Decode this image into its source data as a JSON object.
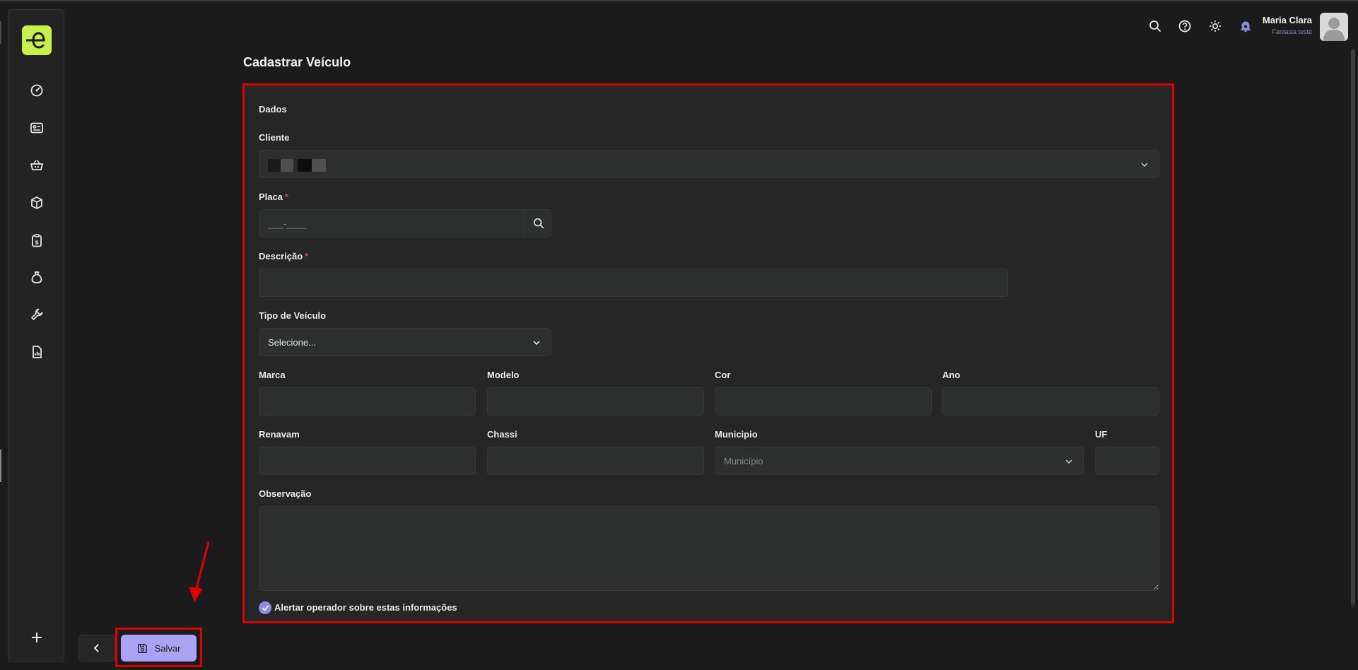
{
  "header": {
    "user_name": "Maria Clara",
    "user_company": "Fantasia teste",
    "icons": [
      "search-icon",
      "help-icon",
      "theme-sun-icon",
      "notifications-icon"
    ]
  },
  "sidebar": {
    "items": [
      "dashboard-icon",
      "id-card-icon",
      "basket-icon",
      "box-icon",
      "clipboard-dollar-icon",
      "money-bag-icon",
      "wrench-icon",
      "report-icon"
    ],
    "add_icon": "plus-icon"
  },
  "page": {
    "title": "Cadastrar Veículo"
  },
  "form": {
    "section_title": "Dados",
    "cliente": {
      "label": "Cliente"
    },
    "placa": {
      "label": "Placa",
      "required": "*",
      "placeholder": "___-____"
    },
    "descricao": {
      "label": "Descrição",
      "required": "*"
    },
    "tipo_veiculo": {
      "label": "Tipo de Veículo",
      "value": "Selecione..."
    },
    "marca": {
      "label": "Marca"
    },
    "modelo": {
      "label": "Modelo"
    },
    "cor": {
      "label": "Cor"
    },
    "ano": {
      "label": "Ano"
    },
    "renavam": {
      "label": "Renavam"
    },
    "chassi": {
      "label": "Chassi"
    },
    "municipio": {
      "label": "Municipio",
      "placeholder": "Município"
    },
    "uf": {
      "label": "UF"
    },
    "observacao": {
      "label": "Observação"
    },
    "alertar": {
      "label": "Alertar operador sobre estas informações",
      "checked": true
    }
  },
  "actions": {
    "save_label": "Salvar"
  },
  "colors": {
    "accent": "#a9a3f3",
    "highlight": "#e00000",
    "logo": "#c6f24a"
  }
}
